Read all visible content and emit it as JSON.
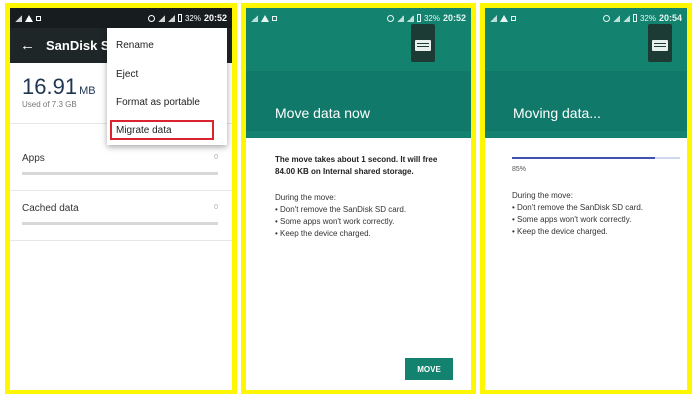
{
  "colors": {
    "highlight": "#fff700",
    "teal": "#13836f",
    "dark_toolbar": "#1f2628",
    "red_outline": "#d9232d",
    "progress": "#3f51b5"
  },
  "panel1": {
    "status_time": "20:52",
    "status_battery": "32%",
    "toolbar_title": "SanDisk S",
    "back_icon": "arrow-left",
    "storage_size": "16.91",
    "storage_unit": "MB",
    "storage_used": "Used of 7.3 GB",
    "rows": [
      {
        "label": "Apps",
        "value": "0"
      },
      {
        "label": "Cached data",
        "value": "0"
      }
    ],
    "menu": [
      "Rename",
      "Eject",
      "Format as portable",
      "Migrate data"
    ]
  },
  "panel2": {
    "status_time": "20:52",
    "status_battery": "32%",
    "title": "Move data now",
    "bold_text": "The move takes about 1 second. It will free 84.00 KB on Internal shared storage.",
    "during_label": "During the move:",
    "bullets": [
      "• Don't remove the SanDisk SD card.",
      "• Some apps won't work correctly.",
      "• Keep the device charged."
    ],
    "button": "MOVE"
  },
  "panel3": {
    "status_time": "20:54",
    "status_battery": "32%",
    "title": "Moving data...",
    "progress_percent": 85,
    "progress_text": "85%",
    "during_label": "During the move:",
    "bullets": [
      "• Don't remove the SanDisk SD card.",
      "• Some apps won't work correctly.",
      "• Keep the device charged."
    ]
  }
}
